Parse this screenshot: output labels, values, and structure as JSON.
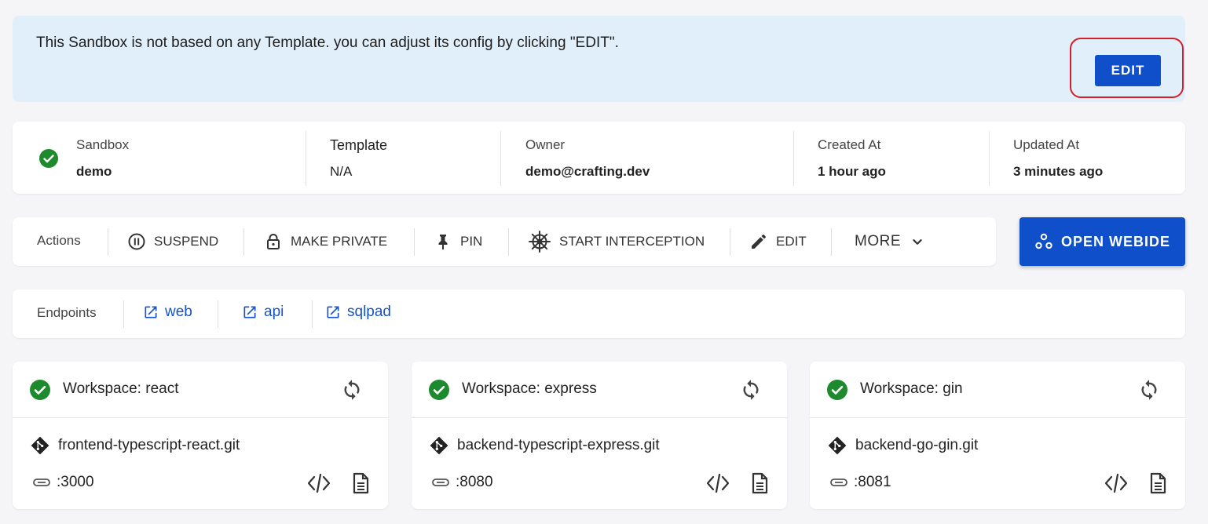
{
  "banner": {
    "message": "This Sandbox is not based on any Template. you can adjust its config by clicking \"EDIT\".",
    "edit_label": "EDIT"
  },
  "info": {
    "sandbox_label": "Sandbox",
    "sandbox_value": "demo",
    "template_label": "Template",
    "template_value": "N/A",
    "owner_label": "Owner",
    "owner_value": "demo@crafting.dev",
    "created_label": "Created At",
    "created_value": "1 hour ago",
    "updated_label": "Updated At",
    "updated_value": "3 minutes ago"
  },
  "actions": {
    "label": "Actions",
    "suspend": "SUSPEND",
    "make_private": "MAKE PRIVATE",
    "pin": "PIN",
    "start_interception": "START INTERCEPTION",
    "edit": "EDIT",
    "more": "MORE"
  },
  "open_webide": "OPEN WEBIDE",
  "endpoints": {
    "label": "Endpoints",
    "items": [
      {
        "label": "web"
      },
      {
        "label": "api"
      },
      {
        "label": "sqlpad"
      }
    ]
  },
  "workspaces": [
    {
      "title": "Workspace: react",
      "repo": "frontend-typescript-react.git",
      "port": ":3000"
    },
    {
      "title": "Workspace: express",
      "repo": "backend-typescript-express.git",
      "port": ":8080"
    },
    {
      "title": "Workspace: gin",
      "repo": "backend-go-gin.git",
      "port": ":8081"
    }
  ],
  "colors": {
    "accent": "#0f4fc9",
    "success": "#1e8a2e",
    "banner_bg": "#e1effb",
    "highlight": "#d0202a",
    "link": "#1553c8"
  },
  "icons": {
    "status": "check-circle-icon",
    "suspend": "pause-circle-icon",
    "private": "lock-icon",
    "pin": "pin-icon",
    "interception": "helm-wheel-icon",
    "edit": "pencil-icon",
    "more": "chevron-down-icon",
    "webide": "nodes-icon",
    "endpoint": "external-link-icon",
    "sync": "sync-icon",
    "repo": "git-icon",
    "port": "port-icon",
    "code": "code-icon",
    "log": "document-icon"
  }
}
